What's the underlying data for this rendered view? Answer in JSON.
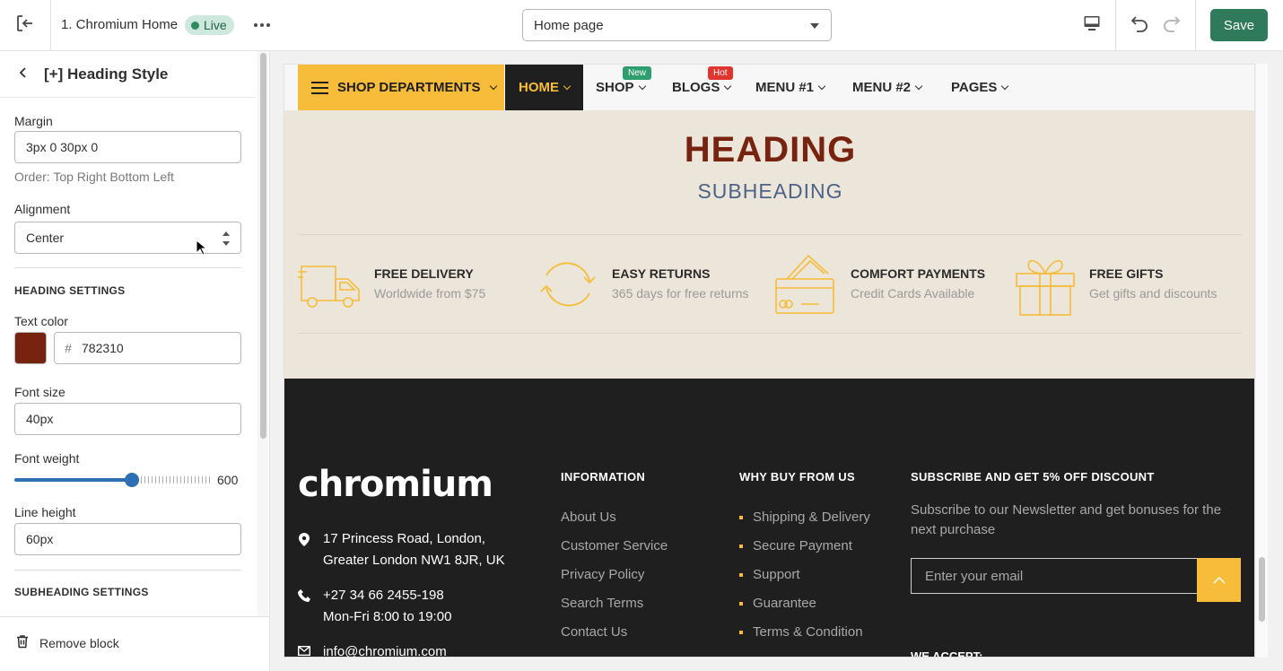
{
  "topbar": {
    "theme_name": "1. Chromium Home",
    "status": "Live",
    "page_select": "Home page",
    "save_label": "Save"
  },
  "sidebar": {
    "title": "[+] Heading Style",
    "margin_label": "Margin",
    "margin_value": "3px 0 30px 0",
    "margin_hint": "Order: Top Right Bottom Left",
    "alignment_label": "Alignment",
    "alignment_value": "Center",
    "heading_settings": "HEADING SETTINGS",
    "text_color_label": "Text color",
    "text_color_hash": "#",
    "text_color_value": "782310",
    "text_color": "#782310",
    "font_size_label": "Font size",
    "font_size_value": "40px",
    "font_weight_label": "Font weight",
    "font_weight_value": "600",
    "font_weight_fraction": 0.6,
    "line_height_label": "Line height",
    "line_height_value": "60px",
    "subheading_settings": "SUBHEADING SETTINGS",
    "remove_label": "Remove block"
  },
  "preview": {
    "nav": {
      "departments": "SHOP DEPARTMENTS",
      "items": [
        {
          "label": "HOME"
        },
        {
          "label": "SHOP",
          "badge": "New"
        },
        {
          "label": "BLOGS",
          "badge": "Hot"
        },
        {
          "label": "MENU #1"
        },
        {
          "label": "MENU #2"
        },
        {
          "label": "PAGES"
        }
      ]
    },
    "heading": "HEADING",
    "subheading": "SUBHEADING",
    "features": [
      {
        "title": "FREE DELIVERY",
        "subtitle": "Worldwide from $75",
        "icon": "truck-icon"
      },
      {
        "title": "EASY RETURNS",
        "subtitle": "365 days for free returns",
        "icon": "returns-icon"
      },
      {
        "title": "COMFORT PAYMENTS",
        "subtitle": "Credit Cards Available",
        "icon": "credit-card-icon"
      },
      {
        "title": "FREE GIFTS",
        "subtitle": "Get gifts and discounts",
        "icon": "gift-icon"
      }
    ],
    "footer": {
      "logo": "chromium",
      "address_line1": "17 Princess Road, London,",
      "address_line2": "Greater London NW1 8JR, UK",
      "phone": "+27 34 66 2455-198",
      "hours": "Mon-Fri 8:00 to 19:00",
      "email": "info@chromium.com",
      "information_title": "INFORMATION",
      "information_links": [
        "About Us",
        "Customer Service",
        "Privacy Policy",
        "Search Terms",
        "Contact Us"
      ],
      "why_title": "WHY BUY FROM US",
      "why_links": [
        "Shipping & Delivery",
        "Secure Payment",
        "Support",
        "Guarantee",
        "Terms & Condition"
      ],
      "subscribe_title": "SUBSCRIBE AND GET 5% OFF DISCOUNT",
      "subscribe_text": "Subscribe to our Newsletter and get bonuses for the next purchase",
      "email_placeholder": "Enter your email",
      "accept_title": "WE ACCEPT:"
    }
  },
  "colors": {
    "accent": "#f6bc3a",
    "save": "#2f7a5b",
    "heading": "#782310",
    "subheading": "#4e6287",
    "badge_new": "#2f9e6e",
    "badge_hot": "#e0342f"
  }
}
